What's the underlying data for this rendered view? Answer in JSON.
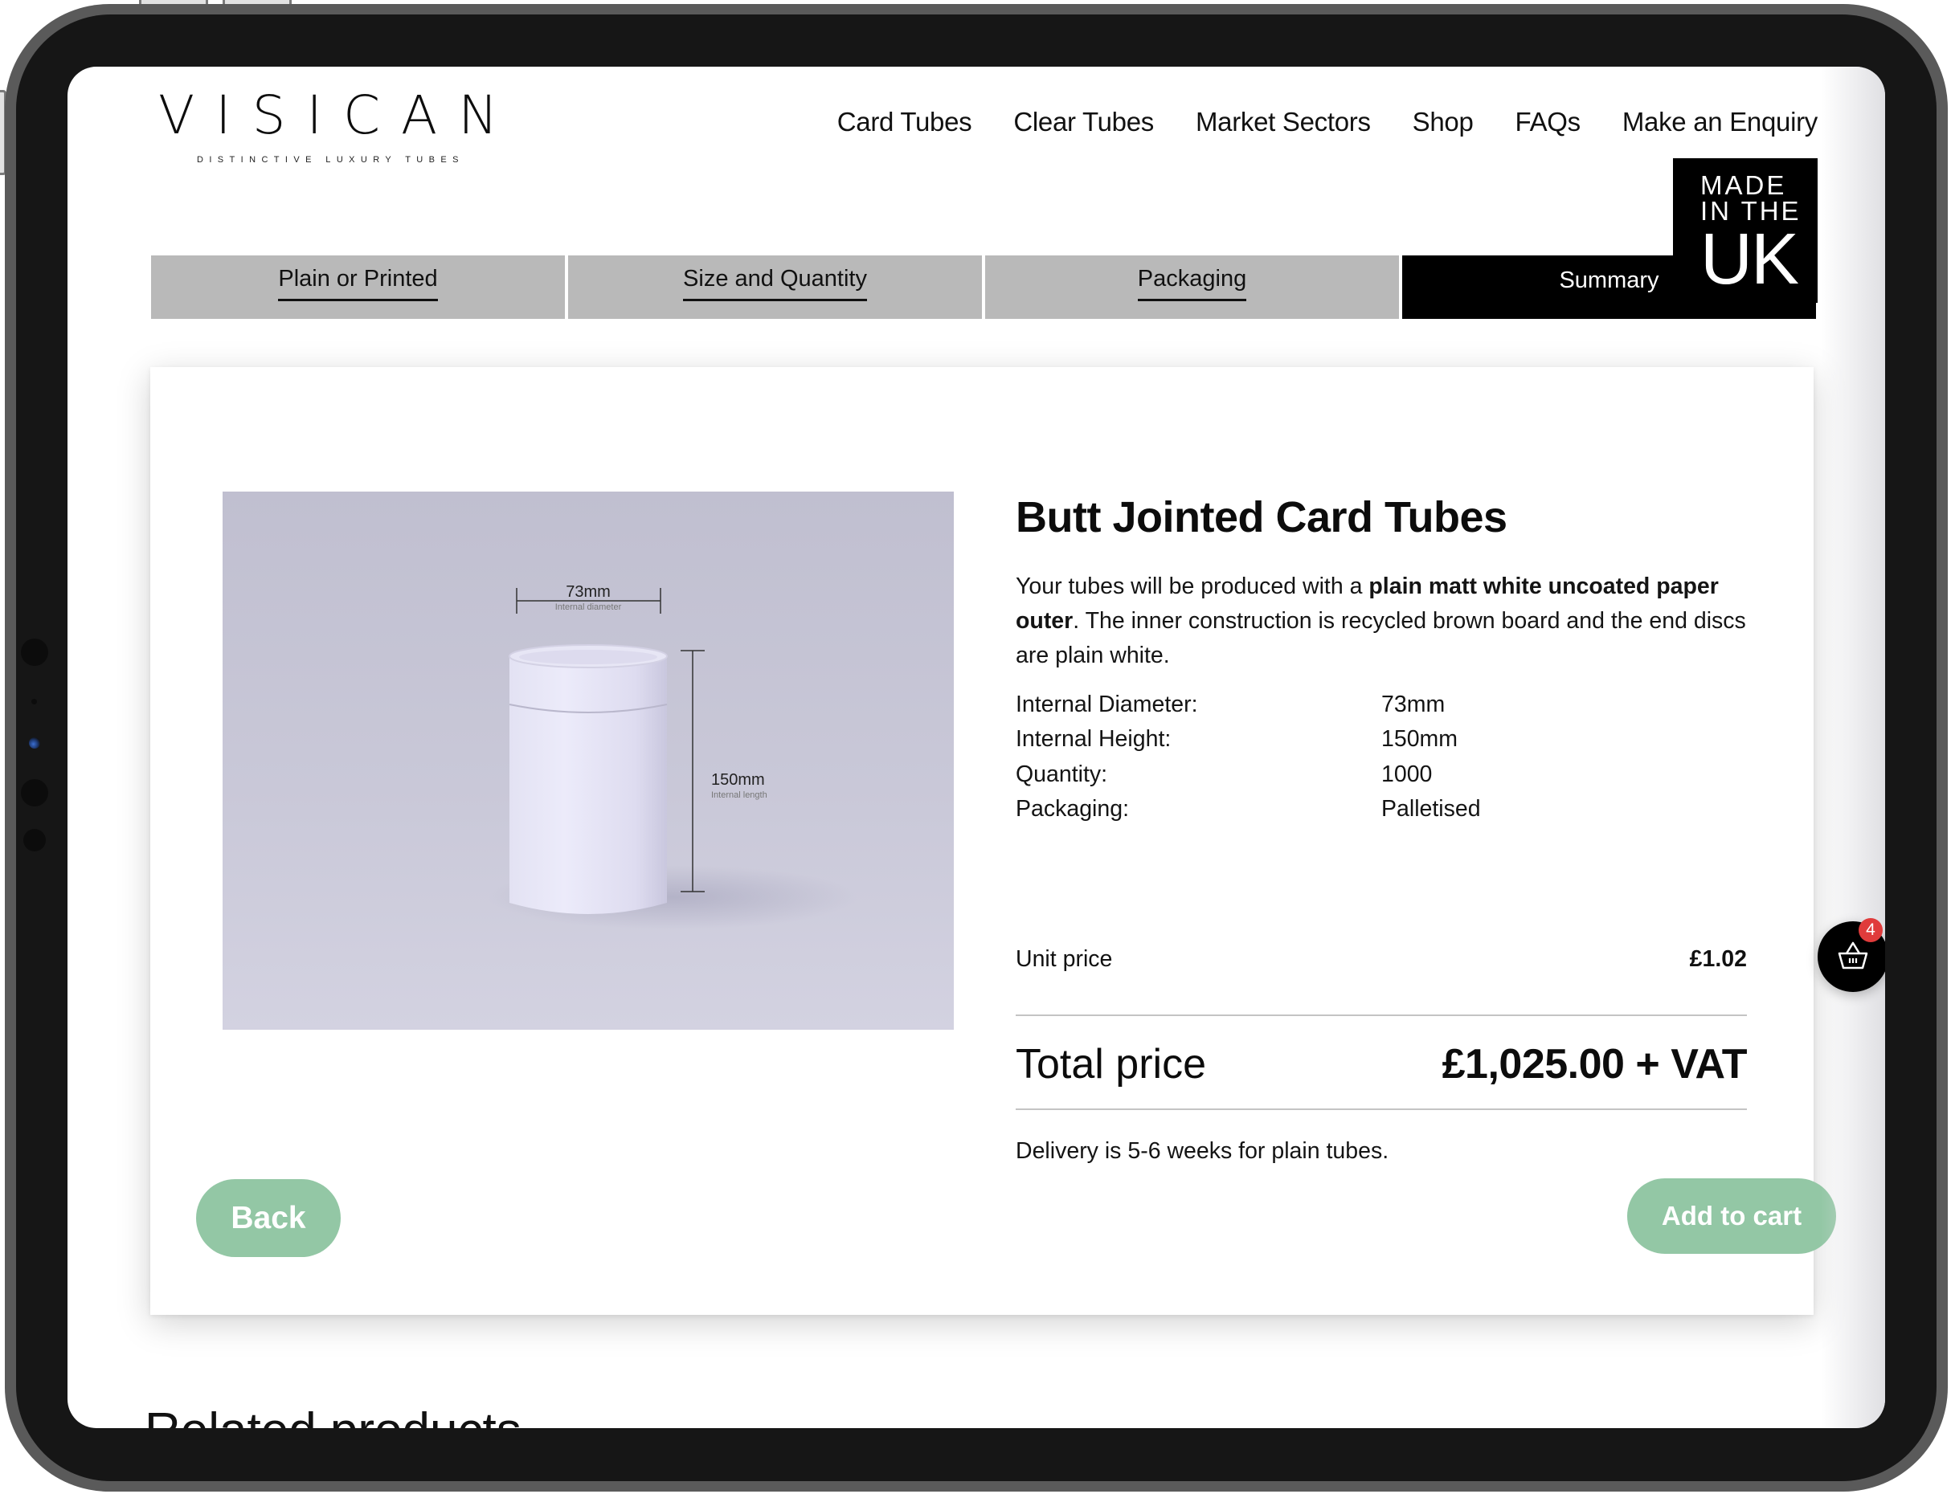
{
  "brand": {
    "name": "VISICAN",
    "tagline": "DISTINCTIVE LUXURY TUBES"
  },
  "nav": {
    "items": [
      {
        "label": "Card Tubes"
      },
      {
        "label": "Clear Tubes"
      },
      {
        "label": "Market Sectors"
      },
      {
        "label": "Shop"
      },
      {
        "label": "FAQs"
      },
      {
        "label": "Make an Enquiry"
      }
    ]
  },
  "badge": {
    "line1": "MADE",
    "line2": "IN THE",
    "line3": "UK"
  },
  "steps": {
    "items": [
      {
        "label": "Plain or Printed",
        "active": false
      },
      {
        "label": "Size and Quantity",
        "active": false
      },
      {
        "label": "Packaging",
        "active": false
      },
      {
        "label": "Summary",
        "active": true
      }
    ]
  },
  "product": {
    "image": {
      "diameter_label": "73mm",
      "diameter_caption": "Internal diameter",
      "length_label": "150mm",
      "length_caption": "Internal length"
    },
    "title": "Butt Jointed Card Tubes",
    "description": {
      "pre": "Your tubes will be produced with a ",
      "bold": "plain matt white uncoated paper outer",
      "post": ". The inner construction is recycled brown board and the end discs are plain white."
    },
    "specs": [
      {
        "label": "Internal Diameter:",
        "value": "73mm"
      },
      {
        "label": "Internal Height:",
        "value": "150mm"
      },
      {
        "label": "Quantity:",
        "value": "1000"
      },
      {
        "label": "Packaging:",
        "value": "Palletised"
      }
    ],
    "unit_price_label": "Unit price",
    "unit_price": "£1.02",
    "total_label": "Total price",
    "total_price": "£1,025.00 + VAT",
    "delivery_note": "Delivery is 5-6 weeks for plain tubes."
  },
  "actions": {
    "back_label": "Back",
    "add_to_cart_label": "Add to cart"
  },
  "cart": {
    "count": "4"
  },
  "related": {
    "heading": "Related products"
  },
  "colors": {
    "button_green": "#93c7a5",
    "tab_inactive": "#b9b9b9",
    "tab_active": "#000000",
    "cart_badge": "#e03b3b"
  }
}
